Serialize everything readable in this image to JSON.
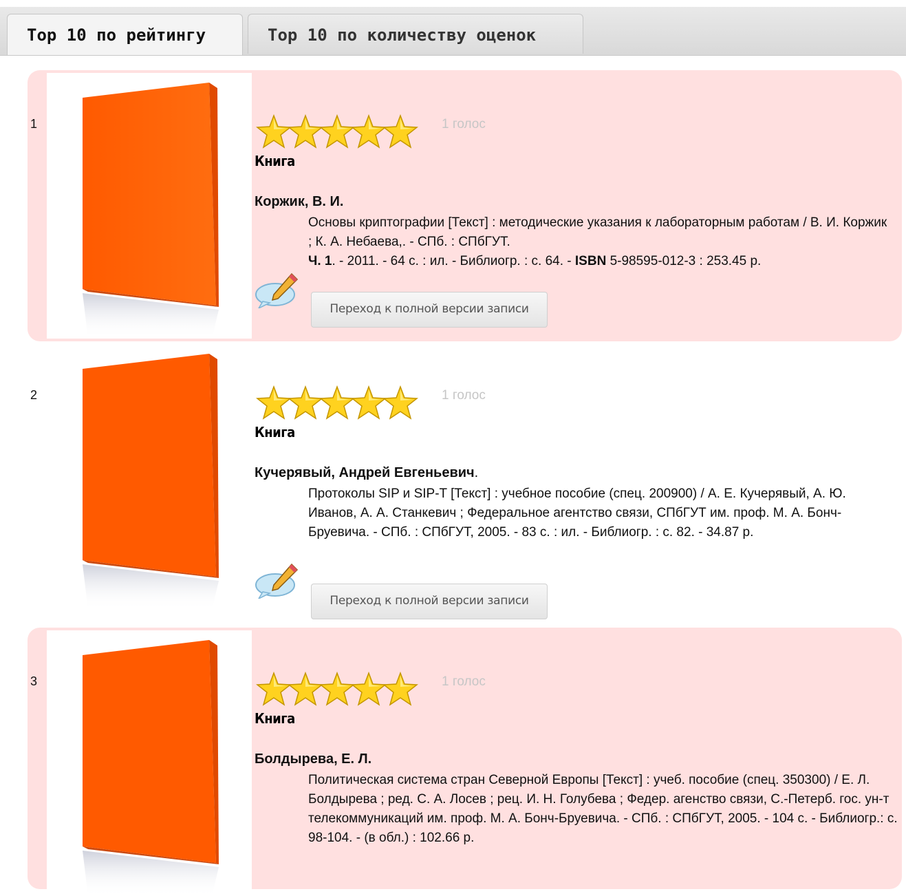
{
  "tabs": [
    {
      "label": "Top 10 по рейтингу",
      "active": true
    },
    {
      "label": "Top 10 по количеству оценок",
      "active": false
    }
  ],
  "colors": {
    "record_highlight": "#ffe0e0",
    "cover": "#ff5a00",
    "star": "#ffd21f",
    "votes_text": "#c6c6c6"
  },
  "records": [
    {
      "number": "1",
      "rating": 5,
      "votes": "1 голос",
      "type": "Книга",
      "author": "Коржик, В. И.",
      "description": "Основы криптографии [Текст] : методические указания к лабораторным работам / В. И. Коржик ; К. А. Небаева,. - СПб. : СПбГУТ.",
      "part_label": "Ч. 1",
      "part_details": ". - 2011. - 64 с. : ил. - Библиогр. : с. 64. - ",
      "isbn_label": "ISBN",
      "isbn_details": " 5-98595-012-3 : 253.45 р.",
      "button_label": "Переход к полной версии записи"
    },
    {
      "number": "2",
      "rating": 5,
      "votes": "1 голос",
      "type": "Книга",
      "author": "Кучерявый, Андрей Евгеньевич",
      "author_suffix": ".",
      "description": "Протоколы SIP и SIP-T [Текст] : учебное пособие (спец. 200900) / А. Е. Кучерявый, А. Ю. Иванов, А. А. Станкевич ; Федеральное агентство связи, СПбГУТ им. проф. М. А. Бонч-Бруевича. - СПб. : СПбГУТ, 2005. - 83 с. : ил. - Библиогр. : с. 82. - 34.87 р.",
      "button_label": "Переход к полной версии записи"
    },
    {
      "number": "3",
      "rating": 5,
      "votes": "1 голос",
      "type": "Книга",
      "author": "Болдырева, Е. Л.",
      "description": "Политическая система стран Северной Европы [Текст] : учеб. пособие (спец. 350300) / Е. Л. Болдырева ; ред. С. А. Лосев ; рец. И. Н. Голубева ; Федер. агенство связи, С.-Петерб. гос. ун-т телекоммуникаций им. проф. М. А. Бонч-Бруевича. - СПб. : СПбГУТ, 2005. - 104 с. - Библиогр.: с. 98-104. - (в обл.) : 102.66 р."
    }
  ]
}
